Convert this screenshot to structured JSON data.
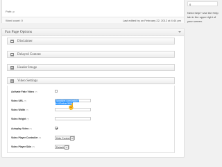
{
  "editor": {
    "path": "Path: p",
    "word_count": "Word count: 0",
    "last_edited": "Last edited by on February 22, 2012 at 4:44 pm"
  },
  "sidebar": {
    "input_value": "0",
    "help_text": "Need help? Use the Help tab in the upper right of your screen."
  },
  "fan_page_options": {
    "title": "Fan Page Options",
    "sections": [
      "Disclaimer",
      "Delayed Content",
      "Header Image",
      "Video Settings"
    ]
  },
  "video_settings": {
    "activate_fake_video": {
      "label": "Activate Fake Video",
      "help": "(?)",
      "checked": false
    },
    "video_url": {
      "label": "Video URL",
      "help": "(?)",
      "value": "/youtube.com/watch?v=4Ewfozx3f08"
    },
    "video_width": {
      "label": "Video Width",
      "help": "(?)",
      "value": ""
    },
    "video_height": {
      "label": "Video Height",
      "help": "(?)",
      "value": ""
    },
    "autoplay_video": {
      "label": "Autoplay Video",
      "help": "(?)",
      "checked": true
    },
    "video_player_controller": {
      "label": "Video Player Controller",
      "help": "(?)",
      "value": "Hide Control"
    },
    "video_player_skin": {
      "label": "Video Player Skin",
      "help": "(?)",
      "value": "Default"
    }
  }
}
